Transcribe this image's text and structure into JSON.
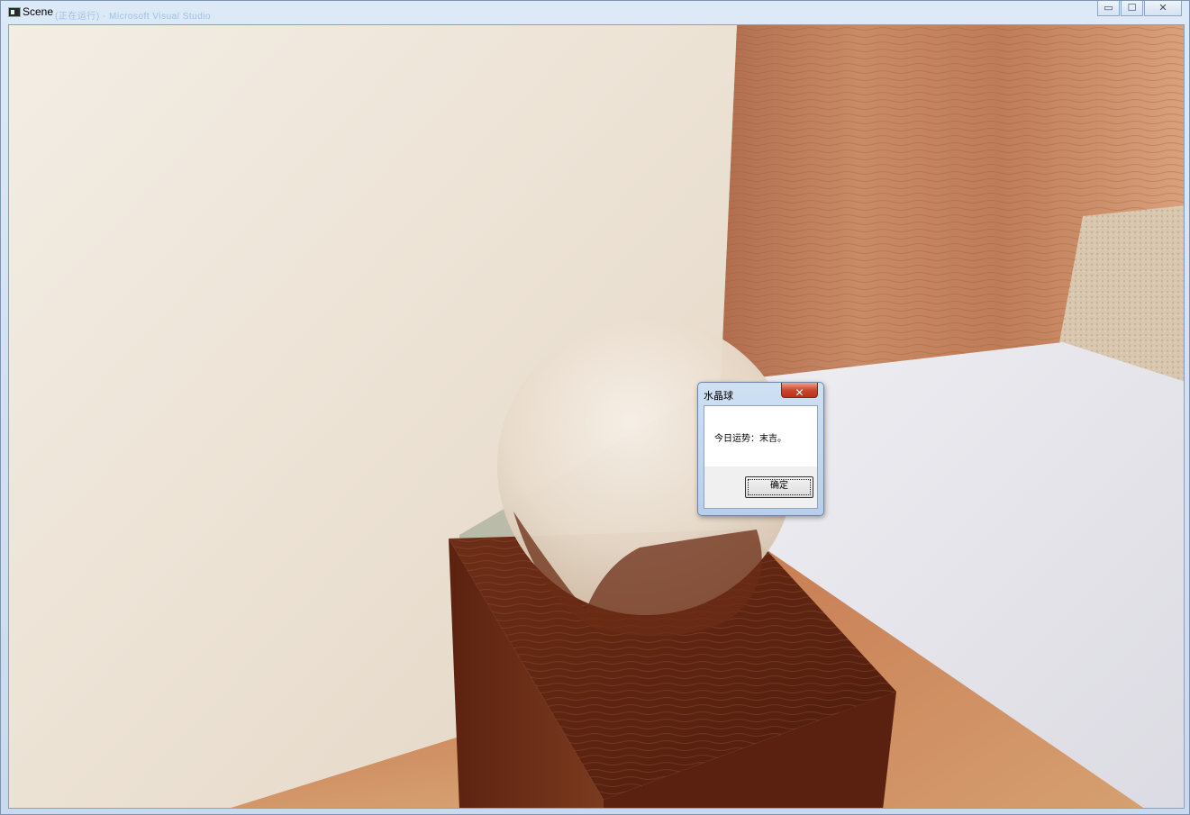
{
  "window": {
    "title": "Scene",
    "ghost_title": "(正在运行) - Microsoft Visual Studio",
    "minimize_label": "▭",
    "maximize_label": "☐",
    "close_label": "✕"
  },
  "dialog": {
    "title": "水晶球",
    "close_label": "✕",
    "message": "今日运势：末吉。",
    "ok_label": "确定"
  },
  "colors": {
    "wall_cream": "#efe6da",
    "wood_light": "#c8896a",
    "wood_dark": "#5a2412",
    "floor_white": "#e4e3ea",
    "close_red": "#c9482f"
  }
}
